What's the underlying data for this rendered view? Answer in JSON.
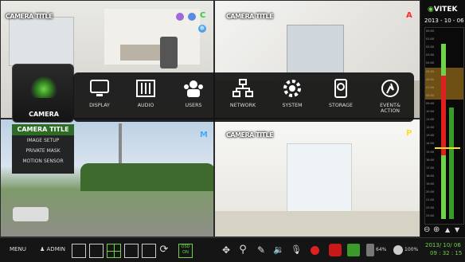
{
  "cameras": [
    {
      "title": "CAMERA TITLE",
      "letter": "",
      "letter_color": "#ffffff"
    },
    {
      "title": "CAMERA TITLE",
      "letter": "A",
      "letter_color": "#ff2a2a"
    },
    {
      "title": "",
      "letter": "M",
      "letter_color": "#44aaff"
    },
    {
      "title": "CAMERA TITLE",
      "letter": "P",
      "letter_color": "#ffdd22"
    }
  ],
  "cam1_status": {
    "c_label": "C"
  },
  "menu": {
    "camera": "CAMERA",
    "items": [
      {
        "label": "DISPLAY",
        "icon": "monitor-icon"
      },
      {
        "label": "AUDIO",
        "icon": "equalizer-icon"
      },
      {
        "label": "USERS",
        "icon": "users-icon"
      },
      {
        "label": "NETWORK",
        "icon": "network-icon"
      },
      {
        "label": "SYSTEM",
        "icon": "gear-icon"
      },
      {
        "label": "STORAGE",
        "icon": "hdd-icon"
      },
      {
        "label": "EVENT&",
        "label2": "ACTION",
        "icon": "event-icon"
      }
    ]
  },
  "submenu": [
    "CAMERA TITLE",
    "IMAGE SETUP",
    "PRIVATE MASK",
    "MOTION SENSOR"
  ],
  "right_panel": {
    "brand": "VITEK",
    "date": "2013 - 10 - 06",
    "hours": [
      "00:00",
      "01:00",
      "02:00",
      "03:00",
      "04:00",
      "05:00",
      "06:00",
      "07:00",
      "08:00",
      "09:00",
      "10:00",
      "11:00",
      "12:00",
      "13:00",
      "14:00",
      "15:00",
      "16:00",
      "17:00",
      "18:00",
      "19:00",
      "20:00",
      "21:00",
      "22:00",
      "23:00"
    ]
  },
  "bottom": {
    "menu": "MENU",
    "user": "ADMIN",
    "osd_line1": "OSD",
    "osd_line2": "ON",
    "hdd_pct": "64%",
    "cpu_pct": "100%",
    "date": "2013/ 10/ 06",
    "time": "09 : 32 : 15"
  },
  "colors": {
    "accent": "#2e6b24",
    "highlight": "#6fd24a",
    "record": "#e02020"
  }
}
